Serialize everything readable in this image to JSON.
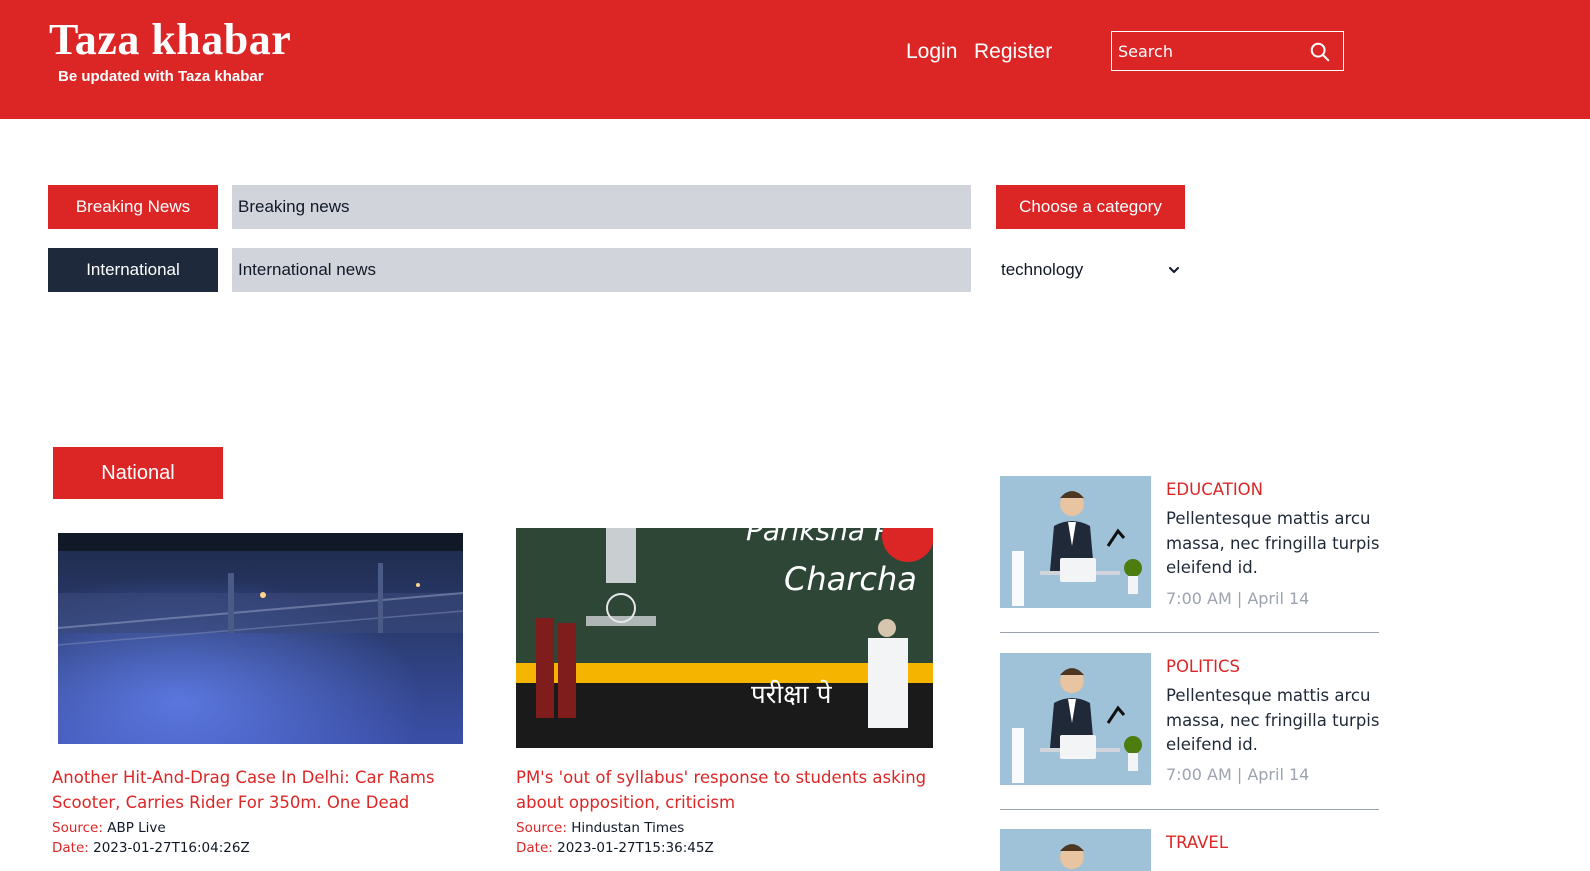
{
  "header": {
    "brand": "Taza khabar",
    "tagline": "Be updated with Taza khabar",
    "login": "Login",
    "register": "Register",
    "search_placeholder": "Search",
    "bg_color": "#dc2626"
  },
  "tickers": {
    "breaking_label": "Breaking News",
    "breaking_text": "Breaking news",
    "international_label": "International",
    "international_text": "International news"
  },
  "category": {
    "button": "Choose a category",
    "selected": "technology"
  },
  "national": {
    "label": "National",
    "articles": [
      {
        "title": "Another Hit-And-Drag Case In Delhi: Car Rams Scooter, Carries Rider For 350m. One Dead",
        "source_label": "Source:",
        "source": "ABP Live",
        "date_label": "Date:",
        "date": "2023-01-27T16:04:26Z"
      },
      {
        "title": "PM's 'out of syllabus' response to students asking about opposition, criticism",
        "source_label": "Source:",
        "source": "Hindustan Times",
        "date_label": "Date:",
        "date": "2023-01-27T15:36:45Z",
        "image_text_1": "Pariksha Pe",
        "image_text_2": "Charcha"
      }
    ]
  },
  "sidebar": {
    "items": [
      {
        "category": "EDUCATION",
        "text": "Pellentesque mattis arcu massa, nec fringilla turpis eleifend id.",
        "time": "7:00 AM | April 14"
      },
      {
        "category": "POLITICS",
        "text": "Pellentesque mattis arcu massa, nec fringilla turpis eleifend id.",
        "time": "7:00 AM | April 14"
      },
      {
        "category": "TRAVEL"
      }
    ]
  }
}
